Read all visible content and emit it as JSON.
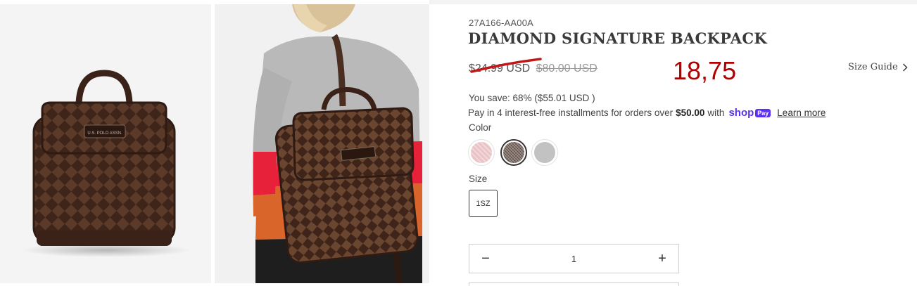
{
  "product": {
    "sku": "27A166-AA00A",
    "title": "DIAMOND SIGNATURE BACKPACK",
    "price_sale": "$24.99 USD",
    "price_compare": "$80.00 USD",
    "price_overlay": "18,75",
    "size_guide_label": "Size Guide",
    "you_save": "You save: 68% ($55.01 USD )",
    "installments_text": "Pay in 4 interest-free installments for orders over",
    "installments_amount": "$50.00",
    "installments_with": "with",
    "shop_logo_text": "shop",
    "shop_pay_badge": "Pay",
    "learn_more": "Learn more",
    "color_label": "Color",
    "size_label": "Size",
    "size_option": "1SZ",
    "quantity": "1",
    "quantity_minus": "−",
    "quantity_plus": "+"
  },
  "swatches": [
    {
      "name": "pink",
      "color": "#e9c3c5",
      "selected": false
    },
    {
      "name": "brown",
      "color": "#7d6a62",
      "selected": true
    },
    {
      "name": "grey",
      "color": "#c2c2c2",
      "selected": false
    }
  ],
  "images": {
    "bag_logo_text": "U.S. POLO ASSN."
  },
  "colors": {
    "accent_red": "#b00000",
    "shop_pay_purple": "#5a31f4",
    "bag_brown_dark": "#4a2e22",
    "bag_brown_light": "#7a5238"
  }
}
